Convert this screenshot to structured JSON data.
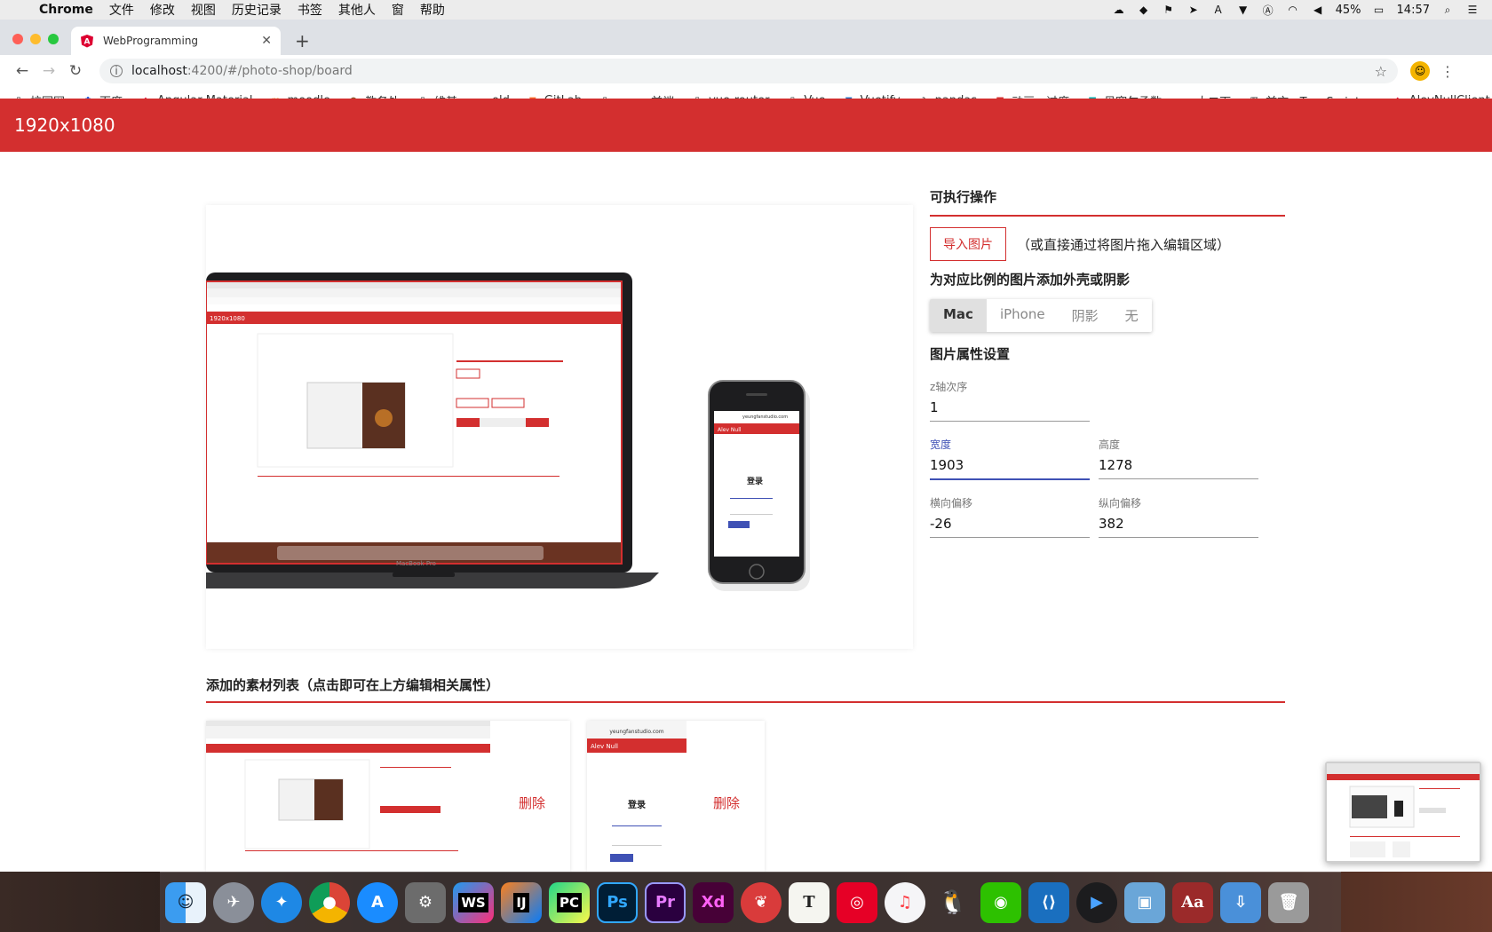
{
  "menubar": {
    "app_name": "Chrome",
    "menus": [
      "文件",
      "修改",
      "视图",
      "历史记录",
      "书签",
      "其他人",
      "窗",
      "帮助"
    ],
    "battery": "45%",
    "time": "14:57"
  },
  "browser": {
    "tab_title": "WebProgramming",
    "url_host": "localhost",
    "url_path": ":4200/#/photo-shop/board",
    "bookmarks": [
      "校园网",
      "百度",
      "Angular Material",
      "moodle",
      "教务处",
      "维基",
      "old",
      "GitLab",
      "",
      "前端",
      "vue-router",
      "Vue",
      "Vuetify",
      "pandas",
      "动画、过度",
      "贝塞尔函数",
      "大二下",
      "前言 · TypeScript ...",
      "AlevNullClient"
    ]
  },
  "app": {
    "title": "1920x1080"
  },
  "panel": {
    "actions_title": "可执行操作",
    "import_button": "导入图片",
    "import_hint": "（或直接通过将图片拖入编辑区域）",
    "shell_title": "为对应比例的图片添加外壳或阴影",
    "shell_options": [
      "Mac",
      "iPhone",
      "阴影",
      "无"
    ],
    "shell_selected": "Mac",
    "props_title": "图片属性设置",
    "z_label": "z轴次序",
    "z_value": "1",
    "width_label": "宽度",
    "width_value": "1903",
    "height_label": "高度",
    "height_value": "1278",
    "offset_x_label": "横向偏移",
    "offset_x_value": "-26",
    "offset_y_label": "纵向偏移",
    "offset_y_value": "382"
  },
  "list": {
    "title": "添加的素材列表（点击即可在上方编辑相关属性）",
    "delete_label": "删除"
  },
  "preview": {
    "macbook_label": "MacBook Pro",
    "phone_url": "yeungfanstudio.com",
    "phone_app_title": "Alev Null",
    "phone_login": "登录",
    "mini_header": "1920x1080"
  },
  "dock": [
    "finder",
    "launchpad",
    "safari",
    "chrome",
    "app-store",
    "system-preferences",
    "WS",
    "IJ",
    "PC",
    "Ps",
    "Pr",
    "Xd",
    "bear",
    "T",
    "netease-music",
    "itunes",
    "qq",
    "wechat",
    "vscode",
    "quicktime",
    "preview",
    "dictionary",
    "downloads",
    "trash"
  ]
}
